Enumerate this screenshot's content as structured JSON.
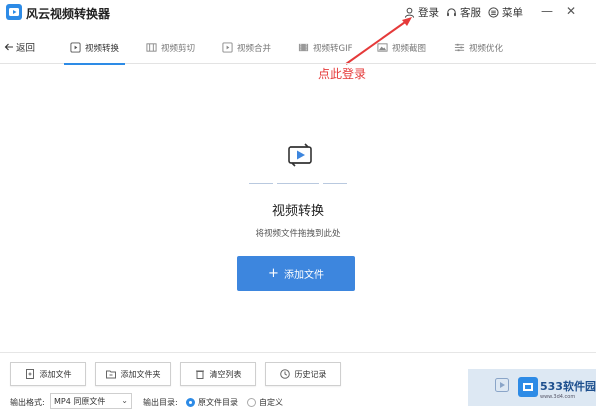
{
  "app": {
    "title": "风云视频转换器"
  },
  "titlebar": {
    "login": "登录",
    "service": "客服",
    "menu": "菜单",
    "minimize": "—",
    "close": "✕"
  },
  "tabbar": {
    "back": "返回",
    "tabs": [
      {
        "label": "视频转换",
        "active": true
      },
      {
        "label": "视频剪切",
        "active": false
      },
      {
        "label": "视频合并",
        "active": false
      },
      {
        "label": "视频转GIF",
        "active": false
      },
      {
        "label": "视频截图",
        "active": false
      },
      {
        "label": "视频优化",
        "active": false
      }
    ]
  },
  "annotation": {
    "text": "点此登录",
    "color": "#e53a3a"
  },
  "main": {
    "title": "视频转换",
    "subtitle": "将视频文件拖拽到此处",
    "add_button": "添加文件"
  },
  "bottom": {
    "buttons": [
      "添加文件",
      "添加文件夹",
      "清空列表",
      "历史记录"
    ],
    "output_format_label": "输出格式:",
    "output_format_value": "MP4 同原文件",
    "output_dir_label": "输出目录:",
    "radio_source": "原文件目录",
    "radio_custom": "自定义"
  },
  "watermark": {
    "brand": "533软件园",
    "url": "www.3d4.com"
  },
  "colors": {
    "accent": "#2d8be6",
    "button": "#3d86de"
  }
}
